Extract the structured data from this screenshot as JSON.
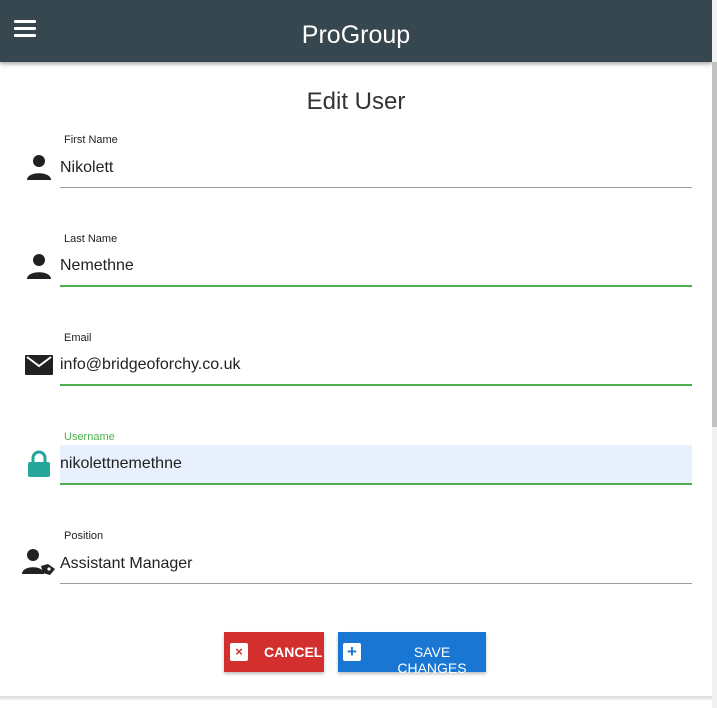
{
  "header": {
    "title": "ProGroup",
    "menu_icon": "hamburger-menu-icon",
    "background": "#37474f"
  },
  "form": {
    "title": "Edit User",
    "fields": [
      {
        "label": "First Name",
        "value": "Nikolett",
        "icon": "person-icon"
      },
      {
        "label": "Last Name",
        "value": "Nemethne",
        "icon": "person-icon"
      },
      {
        "label": "Email",
        "value": "info@bridgeoforchy.co.uk",
        "icon": "envelope-icon"
      },
      {
        "label": "Username",
        "value": "nikolettnemethne",
        "icon": "lock-icon"
      },
      {
        "label": "Position",
        "value": "Assistant Manager",
        "icon": "person-tag-icon"
      }
    ]
  },
  "actions": {
    "cancel_label": "CANCEL",
    "cancel_icon": "close-icon",
    "save_label": "SAVE CHANGES",
    "save_icon": "plus-icon"
  },
  "colors": {
    "cancel": "#d32f2f",
    "save": "#1976d2",
    "valid": "#4caf50",
    "lock_icon": "#26a69a"
  }
}
